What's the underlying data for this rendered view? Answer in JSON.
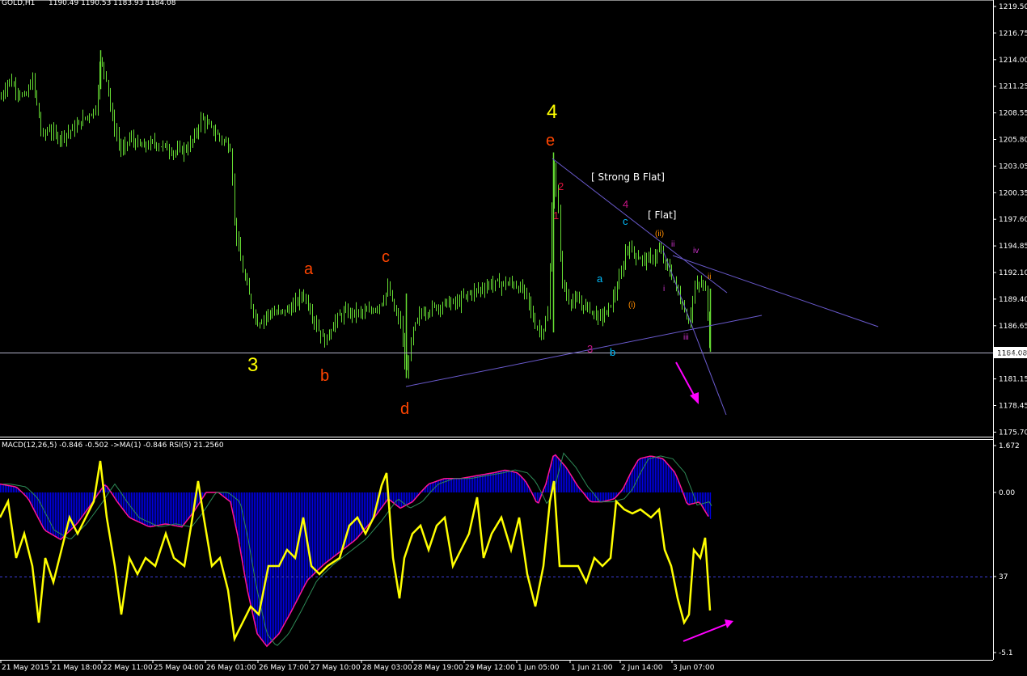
{
  "window": {
    "symbol_header": "GOLD,H1",
    "ohlc_header": "1190.49 1190.53 1183.93 1184.08"
  },
  "price_axis": {
    "ticks": [
      "1219.50",
      "1216.75",
      "1214.00",
      "1211.25",
      "1208.55",
      "1205.80",
      "1203.05",
      "1200.35",
      "1197.60",
      "1194.85",
      "1192.10",
      "1189.40",
      "1186.65",
      "1183.90",
      "1181.15",
      "1178.45",
      "1175.70"
    ],
    "current_price": "1184.08"
  },
  "indicator_panel": {
    "header": "MACD(12,26,5) -0.846 -0.502  ->MA(1) -0.846  RSI(5) 21.2560",
    "ticks": [
      "1.672",
      "0.00",
      "37",
      "-5.1"
    ]
  },
  "time_axis": {
    "labels": [
      "21 May 2015",
      "21 May 18:00",
      "22 May 11:00",
      "25 May 04:00",
      "26 May 01:00",
      "26 May 17:00",
      "27 May 10:00",
      "28 May 03:00",
      "28 May 19:00",
      "29 May 12:00",
      "1 Jun 05:00",
      "1 Jun 21:00",
      "2 Jun 14:00",
      "3 Jun 07:00"
    ]
  },
  "wave_labels": [
    {
      "text": "4",
      "color": "#ffff00",
      "size": "big"
    },
    {
      "text": "e",
      "color": "#ff4500",
      "size": "mid"
    },
    {
      "text": "3",
      "color": "#ffff00",
      "size": "big"
    },
    {
      "text": "a",
      "color": "#ff4500",
      "size": "mid"
    },
    {
      "text": "b",
      "color": "#ff4500",
      "size": "mid"
    },
    {
      "text": "c",
      "color": "#ff4500",
      "size": "mid"
    },
    {
      "text": "d",
      "color": "#ff4500",
      "size": "mid"
    },
    {
      "text": "2",
      "color": "#dc143c",
      "size": "small"
    },
    {
      "text": "1",
      "color": "#dc143c",
      "size": "small"
    },
    {
      "text": "4",
      "color": "#c71585",
      "size": "small"
    },
    {
      "text": "3",
      "color": "#c71585",
      "size": "small"
    },
    {
      "text": "a",
      "color": "#00bfff",
      "size": "small"
    },
    {
      "text": "b",
      "color": "#00bfff",
      "size": "small"
    },
    {
      "text": "c",
      "color": "#00bfff",
      "size": "small"
    },
    {
      "text": "(i)",
      "color": "#ff8c00",
      "size": "tiny"
    },
    {
      "text": "(ii)",
      "color": "#ff8c00",
      "size": "tiny"
    },
    {
      "text": "i",
      "color": "#cc33cc",
      "size": "tiny"
    },
    {
      "text": "ii",
      "color": "#cc33cc",
      "size": "tiny"
    },
    {
      "text": "iii",
      "color": "#cc33cc",
      "size": "tiny"
    },
    {
      "text": "iv",
      "color": "#cc33cc",
      "size": "tiny"
    },
    {
      "text": "ii",
      "color": "#ff8c00",
      "size": "tiny"
    }
  ],
  "notes": {
    "strong_b_flat": "[ Strong B Flat]",
    "flat": "[ Flat]"
  },
  "colors": {
    "background": "#000000",
    "candles": "#66dd33",
    "trendlines": "#6a5acd",
    "arrows": "#ff00ff",
    "macd_hist": "#0000e0",
    "macd_signal": "#ff1493",
    "rsi": "#ffff00",
    "grid_dashed": "#3b3bd8"
  },
  "chart_data": [
    {
      "type": "line",
      "title": "GOLD,H1",
      "ylim": [
        1175.7,
        1219.5
      ],
      "x": [
        "21 May 2015",
        "21 May 18:00",
        "22 May 11:00",
        "25 May 04:00",
        "26 May 01:00",
        "26 May 17:00",
        "27 May 10:00",
        "28 May 03:00",
        "28 May 19:00",
        "29 May 12:00",
        "1 Jun 05:00",
        "1 Jun 21:00",
        "2 Jun 14:00",
        "3 Jun 07:00"
      ],
      "series": [
        {
          "values": [
            1210,
            1210.5,
            1214.5,
            1206,
            1208,
            1188,
            1188,
            1187,
            1181,
            1188.5,
            1190.5,
            1188,
            1194.5,
            1191,
            1184.08
          ]
        }
      ]
    },
    {
      "type": "line",
      "ylim": [
        -5.1,
        1.672
      ],
      "series": [
        {
          "values": [
            0.2,
            -1.5,
            0.3,
            -1.2,
            -0.9,
            0.1,
            -4.9,
            -3.8,
            -2.2,
            -1.0,
            0.4,
            0.6,
            1.4,
            0.1,
            1.2,
            -0.2,
            -0.85
          ]
        }
      ]
    }
  ]
}
